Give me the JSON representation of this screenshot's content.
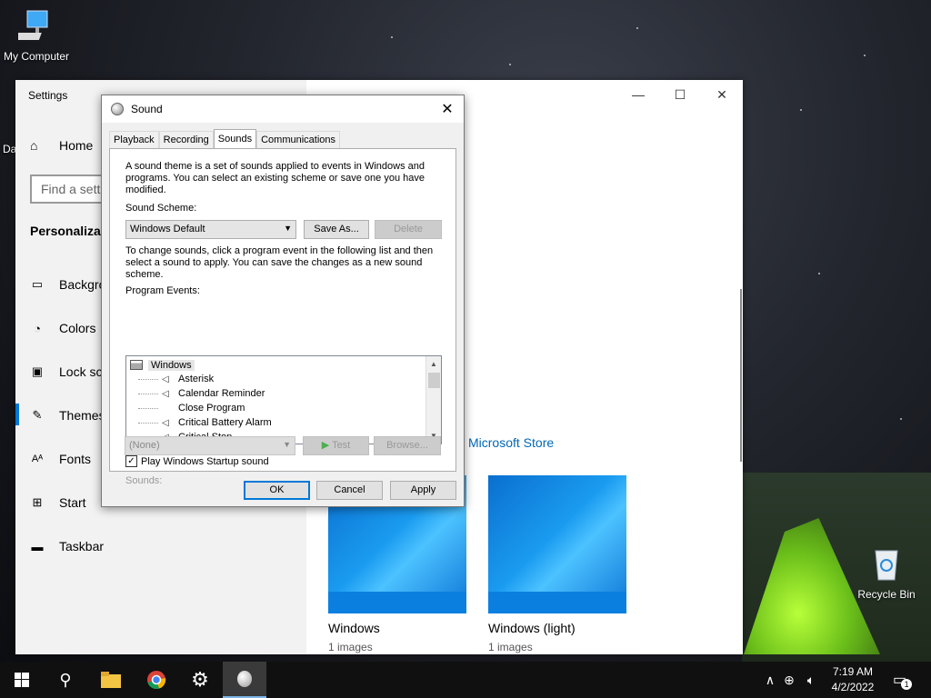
{
  "desktop": {
    "my_computer": "My Computer",
    "recycle_bin": "Recycle Bin",
    "partial_icon_label": "Da"
  },
  "settings": {
    "title": "Settings",
    "controls": {
      "minimize": "—",
      "maximize": "☐",
      "close": "✕"
    },
    "home": "Home",
    "search_placeholder": "Find a setti",
    "section": "Personalizati",
    "nav": [
      {
        "label": "Backgro",
        "icon": "image-icon"
      },
      {
        "label": "Colors",
        "icon": "palette-icon"
      },
      {
        "label": "Lock scr",
        "icon": "lock-screen-icon"
      },
      {
        "label": "Themes",
        "icon": "brush-icon"
      },
      {
        "label": "Fonts",
        "icon": "font-icon"
      },
      {
        "label": "Start",
        "icon": "start-icon"
      },
      {
        "label": "Taskbar",
        "icon": "taskbar-icon"
      }
    ],
    "ms_store_link": "Microsoft Store",
    "themes": [
      {
        "name": "Windows",
        "count": "1 images"
      },
      {
        "name": "Windows (light)",
        "count": "1 images"
      }
    ]
  },
  "sound": {
    "title": "Sound",
    "tabs": [
      "Playback",
      "Recording",
      "Sounds",
      "Communications"
    ],
    "active_tab": "Sounds",
    "intro": "A sound theme is a set of sounds applied to events in Windows and programs.  You can select an existing scheme or save one you have modified.",
    "scheme_label": "Sound Scheme:",
    "scheme_value": "Windows Default",
    "save_as": "Save As...",
    "delete": "Delete",
    "instructions": "To change sounds, click a program event in the following list and then select a sound to apply.  You can save the changes as a new sound scheme.",
    "events_label": "Program Events:",
    "events_root": "Windows",
    "events": [
      {
        "label": "Asterisk",
        "has_sound": true
      },
      {
        "label": "Calendar Reminder",
        "has_sound": true
      },
      {
        "label": "Close Program",
        "has_sound": false
      },
      {
        "label": "Critical Battery Alarm",
        "has_sound": true
      },
      {
        "label": "Critical Stop",
        "has_sound": true
      }
    ],
    "startup_sound": "Play Windows Startup sound",
    "startup_checked": true,
    "sounds_label": "Sounds:",
    "sounds_value": "(None)",
    "test": "Test",
    "browse": "Browse...",
    "ok": "OK",
    "cancel": "Cancel",
    "apply": "Apply"
  },
  "taskbar": {
    "time": "7:19 AM",
    "date": "4/2/2022",
    "notification_count": "1"
  },
  "colors": {
    "accent": "#0078d7",
    "link": "#0067b8"
  }
}
